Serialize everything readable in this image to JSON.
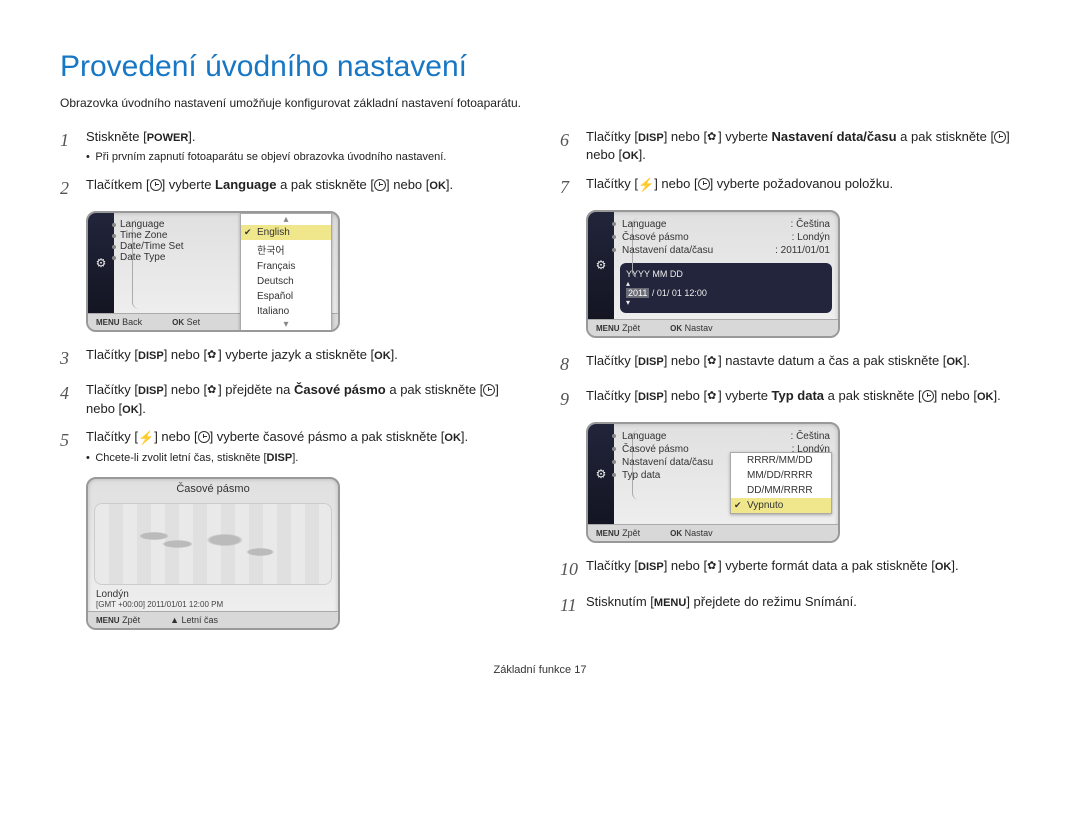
{
  "title": "Provedení úvodního nastavení",
  "intro": "Obrazovka úvodního nastavení umožňuje konfigurovat základní nastavení fotoaparátu.",
  "btn": {
    "power": "POWER",
    "disp": "DISP",
    "ok": "OK",
    "menu": "MENU"
  },
  "steps": {
    "1": {
      "pre": "Stiskněte [",
      "post": "].",
      "sub": "Při prvním zapnutí fotoaparátu se objeví obrazovka úvodního nastavení."
    },
    "2": {
      "a": "Tlačítkem [",
      "b": "] vyberte ",
      "strong": "Language",
      "c": " a pak stiskněte [",
      "d": "] nebo [",
      "e": "]."
    },
    "3": {
      "a": "Tlačítky [",
      "b": "] nebo [",
      "c": "] vyberte jazyk a stiskněte [",
      "d": "]."
    },
    "4": {
      "a": "Tlačítky [",
      "b": "] nebo [",
      "c": "] přejděte na ",
      "strong": "Časové pásmo",
      "d": " a pak stiskněte [",
      "e": "] nebo [",
      "f": "]."
    },
    "5": {
      "a": "Tlačítky [",
      "b": "] nebo [",
      "c": "] vyberte časové pásmo a pak stiskněte [",
      "d": "].",
      "sub": "Chcete-li zvolit letní čas, stiskněte [",
      "sub2": "]."
    },
    "6": {
      "a": "Tlačítky [",
      "b": "] nebo [",
      "c": "] vyberte ",
      "strong": "Nastavení data/času",
      "d": " a pak stiskněte [",
      "e": "] nebo [",
      "f": "]."
    },
    "7": {
      "a": "Tlačítky [",
      "b": "] nebo [",
      "c": "] vyberte požadovanou položku."
    },
    "8": {
      "a": "Tlačítky [",
      "b": "] nebo [",
      "c": "] nastavte datum a čas a pak stiskněte [",
      "d": "]."
    },
    "9": {
      "a": "Tlačítky [",
      "b": "] nebo [",
      "c": "] vyberte ",
      "strong": "Typ data",
      "d": " a pak stiskněte [",
      "e": "] nebo [",
      "f": "]."
    },
    "10": {
      "a": "Tlačítky [",
      "b": "] nebo [",
      "c": "] vyberte formát data a pak stiskněte [",
      "d": "]."
    },
    "11": {
      "a": "Stisknutím [",
      "b": "] přejdete do režimu Snímání."
    }
  },
  "lcd1": {
    "rows": [
      "Language",
      "Time Zone",
      "Date/Time Set",
      "Date Type"
    ],
    "dropdown": [
      "English",
      "한국어",
      "Français",
      "Deutsch",
      "Español",
      "Italiano"
    ],
    "footer_l": "Back",
    "footer_r": "Set"
  },
  "lcd_tz": {
    "title": "Časové pásmo",
    "city": "Londýn",
    "gmt": "[GMT +00:00]   2011/01/01   12:00 PM",
    "footer_l": "Zpět",
    "footer_r": "Letní čas"
  },
  "lcd2": {
    "rows": [
      [
        "Language",
        ": Čeština"
      ],
      [
        "Časové pásmo",
        ": Londýn"
      ],
      [
        "Nastavení data/času",
        ": 2011/01/01"
      ]
    ],
    "datefmt": "YYYY MM DD",
    "dateval": "2011 / 01/ 01  12:00",
    "footer_l": "Zpět",
    "footer_r": "Nastav"
  },
  "lcd3": {
    "rows": [
      [
        "Language",
        ": Čeština"
      ],
      [
        "Časové pásmo",
        ": Londýn"
      ],
      [
        "Nastavení data/času",
        ""
      ],
      [
        "Typ data",
        ""
      ]
    ],
    "dropdown": [
      "RRRR/MM/DD",
      "MM/DD/RRRR",
      "DD/MM/RRRR",
      "Vypnuto"
    ],
    "footer_l": "Zpět",
    "footer_r": "Nastav"
  },
  "footer": "Základní funkce  17"
}
